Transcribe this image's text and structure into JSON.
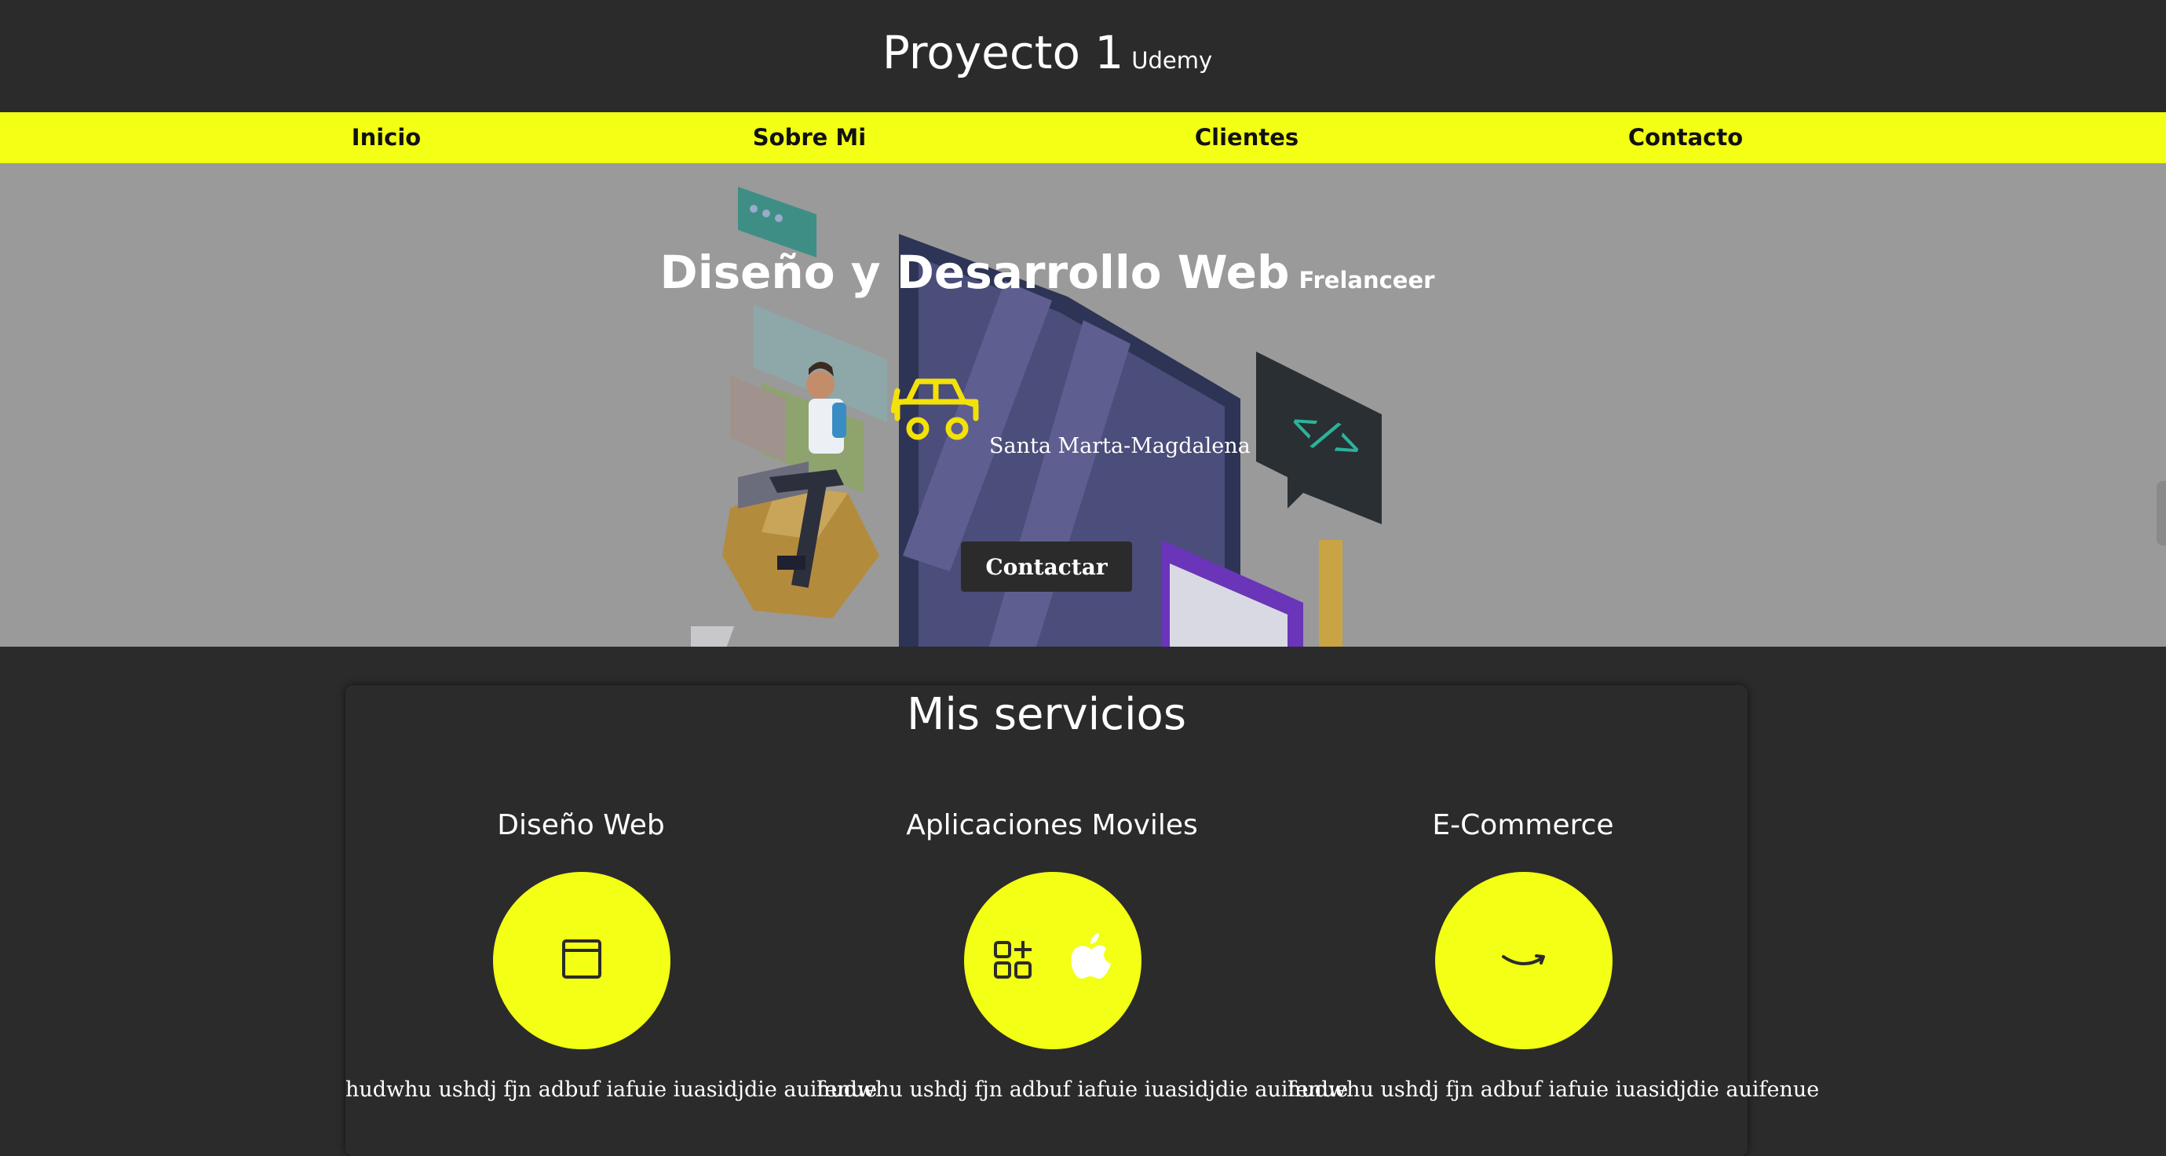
{
  "header": {
    "title": "Proyecto 1",
    "subtitle": "Udemy"
  },
  "nav": {
    "items": [
      "Inicio",
      "Sobre Mi",
      "Clientes",
      "Contacto"
    ]
  },
  "hero": {
    "title": "Diseño y Desarrollo Web",
    "tag": "Frelanceer",
    "location": "Santa Marta-Magdalena",
    "button": "Contactar"
  },
  "services": {
    "title": "Mis servicios",
    "items": [
      {
        "name": "Diseño Web",
        "icon": "browser-window-icon",
        "text": "hudwhu ushdj fjn adbuf iafuie iuasidjdie auifenue"
      },
      {
        "name": "Aplicaciones Moviles",
        "icon": "apps-apple-icon",
        "text": "hudwhu ushdj fjn adbuf iafuie iuasidjdie auifenue"
      },
      {
        "name": "E-Commerce",
        "icon": "amazon-smile-icon",
        "text": "hudwhu ushdj fjn adbuf iafuie iuasidjdie auifenue"
      }
    ]
  },
  "colors": {
    "accent": "#f3ff14",
    "dark": "#2b2b2b",
    "hero_bg": "#9a9a9a"
  }
}
